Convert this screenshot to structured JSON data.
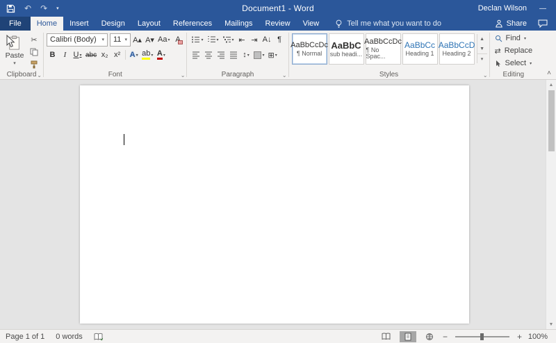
{
  "colors": {
    "accent_blue": "#2b579a",
    "heading_blue": "#2e74b5",
    "highlight_yellow": "#ffff00",
    "font_color_red": "#c00000"
  },
  "titlebar": {
    "title": "Document1 - Word",
    "user": "Declan Wilson"
  },
  "tabs": {
    "file": "File",
    "active": "Home",
    "items": [
      "Home",
      "Insert",
      "Design",
      "Layout",
      "References",
      "Mailings",
      "Review",
      "View"
    ],
    "tell_me": "Tell me what you want to do",
    "share": "Share"
  },
  "ribbon": {
    "clipboard": {
      "paste_label": "Paste",
      "group_label": "Clipboard"
    },
    "font": {
      "font_name": "Calibri (Body)",
      "font_size": "11",
      "group_label": "Font"
    },
    "paragraph": {
      "group_label": "Paragraph"
    },
    "styles": {
      "group_label": "Styles",
      "items": [
        {
          "preview": "AaBbCcDc",
          "name": "¶ Normal"
        },
        {
          "preview": "AaBbC",
          "name": "sub headi..."
        },
        {
          "preview": "AaBbCcDc",
          "name": "¶ No Spac..."
        },
        {
          "preview": "AaBbCc",
          "name": "Heading 1"
        },
        {
          "preview": "AaBbCcD",
          "name": "Heading 2"
        }
      ]
    },
    "editing": {
      "group_label": "Editing",
      "find_label": "Find",
      "replace_label": "Replace",
      "select_label": "Select"
    }
  },
  "icons": {
    "undo": "↶",
    "redo": "↷",
    "caret": "▾",
    "minimize": "—",
    "cut": "✂",
    "bold": "B",
    "italic": "I",
    "underline": "U",
    "strikethrough": "abc",
    "subscript": "x₂",
    "superscript": "x²",
    "text_effects": "A",
    "highlight": "ab",
    "font_color": "A",
    "grow_font": "A▴",
    "shrink_font": "A▾",
    "change_case": "Aa",
    "clear_formatting": "A",
    "outdent": "⇤",
    "indent": "⇥",
    "sort": "A↓",
    "pilcrow": "¶",
    "line_spacing": "↕",
    "borders": "⊞",
    "replace": "⇄",
    "collapse_ribbon": "˄",
    "launcher": "⌄",
    "zoom_out": "−",
    "zoom_in": "+",
    "scroll_up": "▲",
    "scroll_down": "▼"
  },
  "statusbar": {
    "page": "Page 1 of 1",
    "words": "0 words",
    "zoom": "100%"
  }
}
